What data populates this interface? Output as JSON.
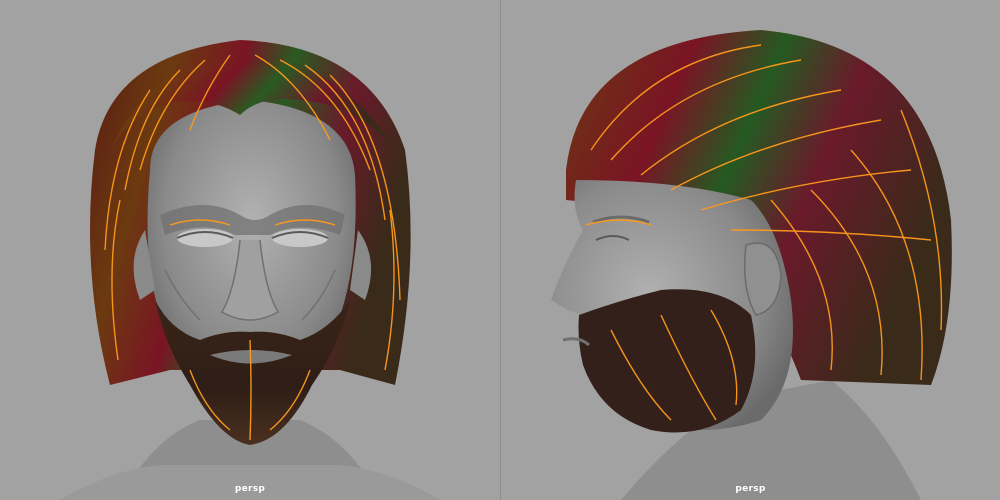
{
  "viewports": [
    {
      "camera": "persp",
      "view": "front"
    },
    {
      "camera": "persp",
      "view": "side"
    }
  ],
  "colors": {
    "background": "#a2a2a2",
    "skin": "#8c8c8c",
    "skin_shadow": "#6e6e6e",
    "skin_highlight": "#b4b4b4",
    "hair_red": "#7a1424",
    "hair_green": "#1f5a22",
    "hair_brown": "#4a2a1a",
    "guide_curves": "#ff9a1a",
    "label_text": "#ffffff"
  }
}
